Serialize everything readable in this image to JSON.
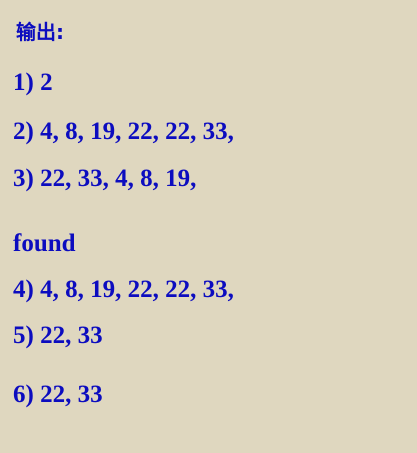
{
  "heading": "输出:",
  "lines": [
    "1) 2",
    "2) 4, 8, 19, 22, 22, 33,",
    "3) 22, 33, 4, 8, 19,",
    "found",
    "4) 4, 8, 19, 22, 22, 33,",
    "5) 22, 33",
    "6) 22, 33"
  ]
}
